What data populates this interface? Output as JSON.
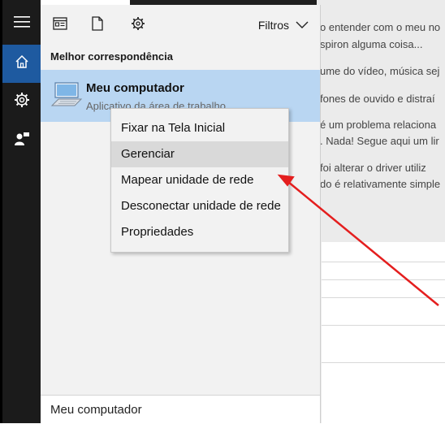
{
  "background_page": {
    "lines": [
      "o entender com o meu no",
      "spiron alguma coisa...",
      "ume do vídeo, música sej",
      "fones de ouvido e distraí",
      "é um problema relaciona",
      ". Nada! Segue aqui um lir",
      "foi alterar o driver utiliz",
      "do é relativamente simple"
    ]
  },
  "rail": {
    "items": [
      {
        "icon": "hamburger-icon"
      },
      {
        "icon": "home-icon",
        "active": true
      },
      {
        "icon": "settings-icon"
      },
      {
        "icon": "user-feedback-icon"
      }
    ]
  },
  "toolbar": {
    "icons": [
      "apps-icon",
      "document-icon",
      "gear-icon"
    ],
    "filter_label": "Filtros"
  },
  "results": {
    "heading": "Melhor correspondência",
    "best_match": {
      "title": "Meu computador",
      "subtitle": "Aplicativo da área de trabalho",
      "icon": "computer-icon"
    }
  },
  "context_menu": {
    "items": [
      {
        "label": "Fixar na Tela Inicial"
      },
      {
        "label": "Gerenciar",
        "highlighted": true
      },
      {
        "label": "Mapear unidade de rede"
      },
      {
        "label": "Desconectar unidade de rede"
      },
      {
        "label": "Propriedades"
      }
    ]
  },
  "search": {
    "value": "Meu computador"
  },
  "colors": {
    "rail_bg": "#1b1b1b",
    "rail_active": "#1e5aa0",
    "panel_bg": "#f2f2f2",
    "result_highlight": "#b9d6f2",
    "arrow": "#e41e1e"
  }
}
